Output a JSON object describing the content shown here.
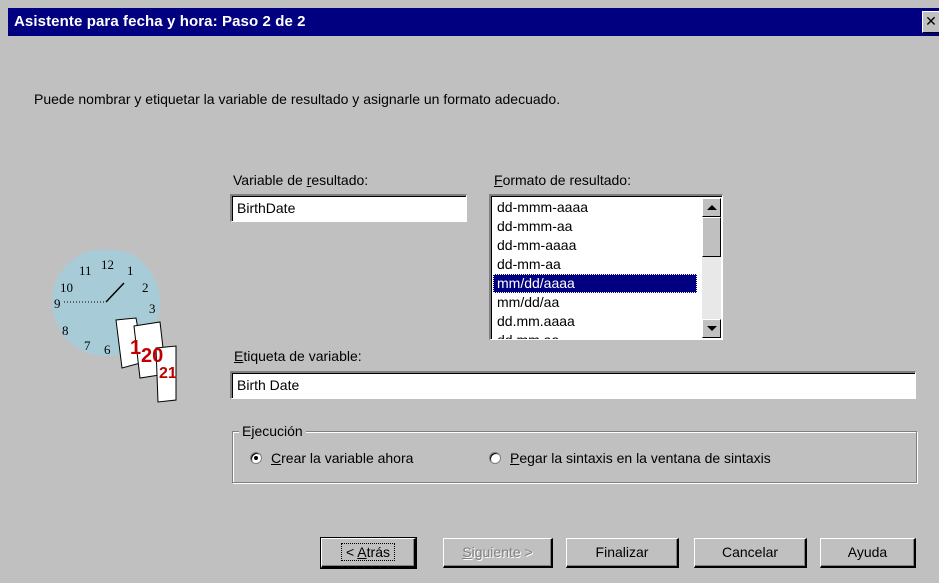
{
  "window": {
    "title": "Asistente para fecha y hora: Paso 2 de 2",
    "close_glyph": "✕"
  },
  "intro_text": "Puede nombrar y etiquetar la variable de resultado y asignarle un formato adecuado.",
  "result_variable": {
    "label_pre": "Variable de ",
    "label_ul": "r",
    "label_post": "esultado:",
    "value": "BirthDate"
  },
  "result_format": {
    "label_ul": "F",
    "label_post": "ormato de resultado:",
    "options": [
      "dd-mmm-aaaa",
      "dd-mmm-aa",
      "dd-mm-aaaa",
      "dd-mm-aa",
      "mm/dd/aaaa",
      "mm/dd/aa",
      "dd.mm.aaaa",
      "dd.mm.aa"
    ],
    "selected": "mm/dd/aaaa"
  },
  "variable_label": {
    "label_ul": "E",
    "label_post": "tiqueta de variable:",
    "value": "Birth Date"
  },
  "execution": {
    "legend": "Ejecución",
    "options": [
      {
        "ul": "C",
        "rest": "rear la variable ahora",
        "checked": true
      },
      {
        "ul": "P",
        "rest": "egar la sintaxis en la ventana de sintaxis",
        "checked": false
      }
    ]
  },
  "clock_art": {
    "numbers": [
      "12",
      "1",
      "2",
      "3",
      "11",
      "10",
      "9",
      "8",
      "7",
      "6"
    ],
    "calendar_pages": [
      "1",
      "20",
      "21"
    ]
  },
  "buttons": {
    "back": {
      "pre": "< ",
      "ul": "A",
      "post": "trás"
    },
    "next": {
      "ul": "S",
      "post": "iguiente >"
    },
    "finish": "Finalizar",
    "cancel": "Cancelar",
    "help": "Ayuda"
  },
  "colors": {
    "dialog_bg": "#c0c0c0",
    "titlebar_bg": "#000080",
    "selection_bg": "#000080"
  }
}
